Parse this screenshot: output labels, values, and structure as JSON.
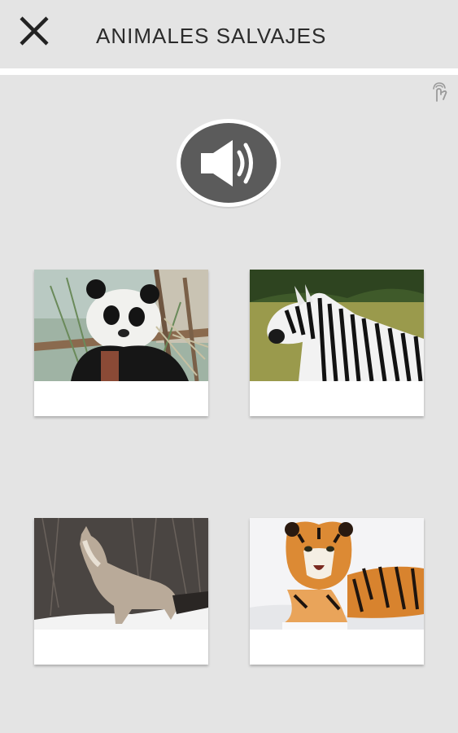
{
  "header": {
    "title": "ANIMALES SALVAJES",
    "close_icon": "close-icon"
  },
  "toolbar": {
    "gesture_icon": "touch-gesture-icon",
    "speaker_icon": "speaker-volume-icon"
  },
  "cards": [
    {
      "id": "panda",
      "image": "panda-photo",
      "caption": ""
    },
    {
      "id": "zebra",
      "image": "zebra-photo",
      "caption": ""
    },
    {
      "id": "wolf",
      "image": "wolf-photo",
      "caption": ""
    },
    {
      "id": "tiger",
      "image": "tiger-photo",
      "caption": ""
    }
  ],
  "colors": {
    "background": "#e4e4e4",
    "speaker_button": "#595959",
    "title_text": "#2b2b2b"
  }
}
